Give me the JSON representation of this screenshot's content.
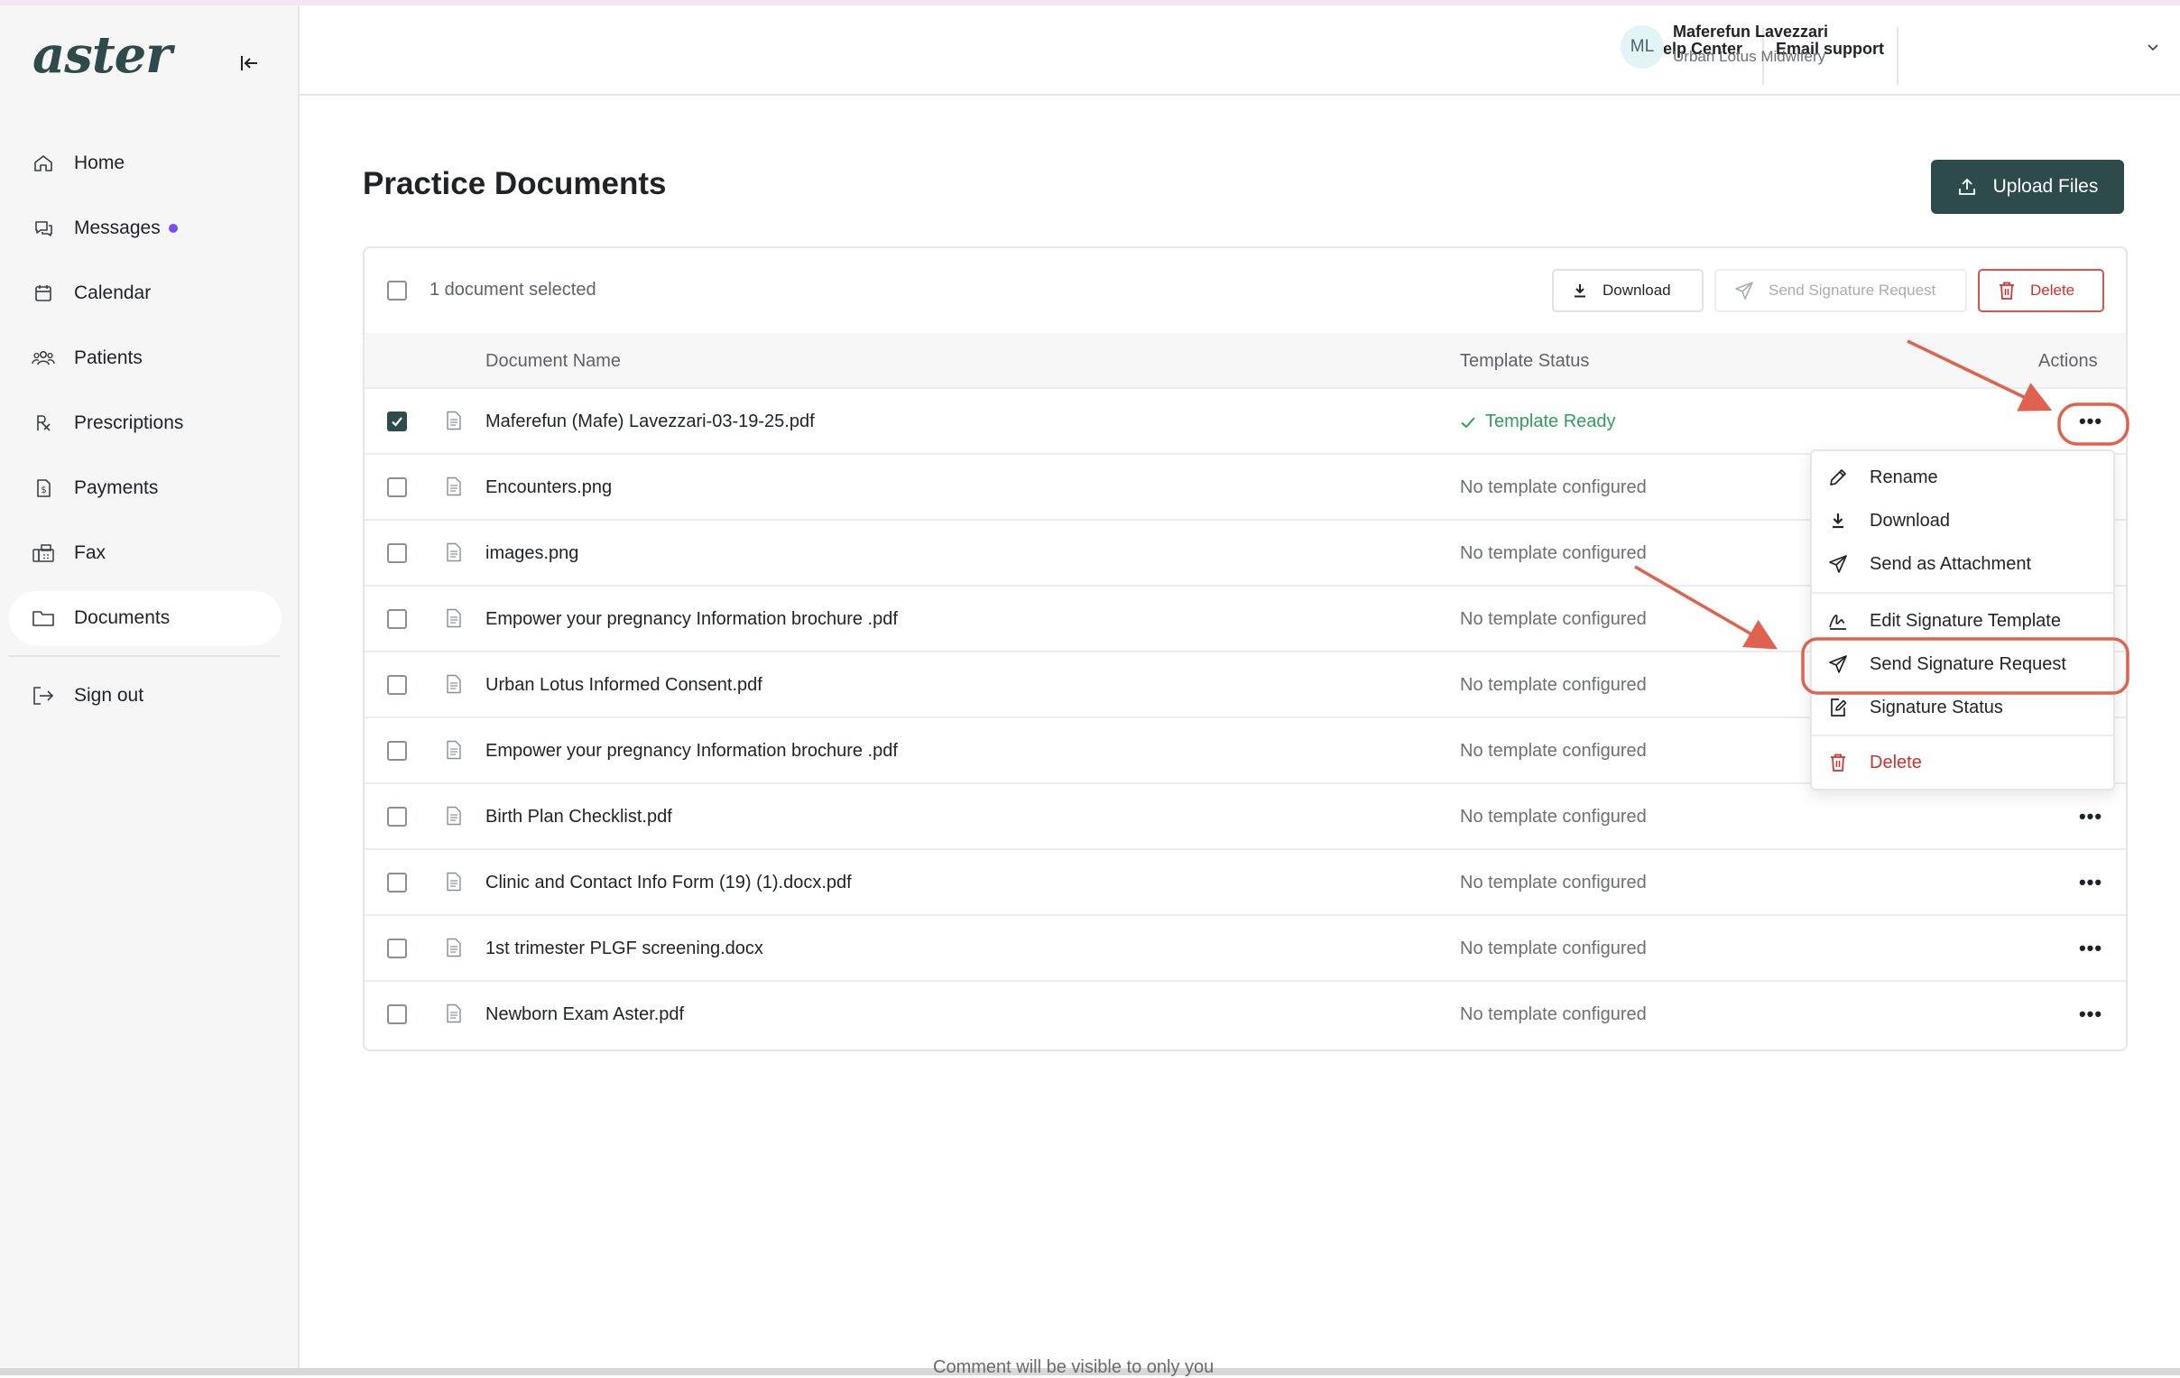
{
  "app": {
    "logo": "aster",
    "colors": {
      "primary": "#2e4b4b",
      "danger": "#d12f2f",
      "success": "#2f9e5b",
      "accent_dot": "#7c4dff",
      "annotation": "#e0624e"
    }
  },
  "sidebar": {
    "items": [
      {
        "label": "Home",
        "icon": "home-icon"
      },
      {
        "label": "Messages",
        "icon": "messages-icon",
        "unread_dot": true
      },
      {
        "label": "Calendar",
        "icon": "calendar-icon"
      },
      {
        "label": "Patients",
        "icon": "patients-icon"
      },
      {
        "label": "Prescriptions",
        "icon": "prescriptions-icon"
      },
      {
        "label": "Payments",
        "icon": "payments-icon"
      },
      {
        "label": "Fax",
        "icon": "fax-icon"
      },
      {
        "label": "Documents",
        "icon": "folder-icon",
        "active": true
      }
    ],
    "signout": "Sign out"
  },
  "header": {
    "help_center": "Help Center",
    "email_support": "Email support",
    "user": {
      "initials": "ML",
      "name": "Maferefun Lavezzari",
      "org": "Urban Lotus Midwifery"
    }
  },
  "main": {
    "title": "Practice Documents",
    "upload_label": "Upload Files",
    "toolbar": {
      "selected_text": "1 document selected",
      "download": "Download",
      "send_signature_request": "Send Signature Request",
      "delete": "Delete"
    },
    "columns": {
      "name": "Document Name",
      "status": "Template Status",
      "actions": "Actions"
    },
    "rows": [
      {
        "name": "Maferefun (Mafe) Lavezzari-03-19-25.pdf",
        "status": "Template Ready",
        "checked": true
      },
      {
        "name": "Encounters.png",
        "status": "No template configured",
        "checked": false
      },
      {
        "name": "images.png",
        "status": "No template configured",
        "checked": false
      },
      {
        "name": "Empower your pregnancy Information brochure .pdf",
        "status": "No template configured",
        "checked": false
      },
      {
        "name": "Urban Lotus Informed Consent.pdf",
        "status": "No template configured",
        "checked": false
      },
      {
        "name": "Empower your pregnancy Information brochure .pdf",
        "status": "No template configured",
        "checked": false
      },
      {
        "name": "Birth Plan Checklist.pdf",
        "status": "No template configured",
        "checked": false
      },
      {
        "name": "Clinic and Contact Info Form (19) (1).docx.pdf",
        "status": "No template configured",
        "checked": false
      },
      {
        "name": "1st trimester PLGF screening.docx",
        "status": "No template configured",
        "checked": false
      },
      {
        "name": "Newborn Exam Aster.pdf",
        "status": "No template configured",
        "checked": false
      }
    ]
  },
  "menu": {
    "items": [
      {
        "label": "Rename",
        "icon": "pencil-icon"
      },
      {
        "label": "Download",
        "icon": "download-icon"
      },
      {
        "label": "Send as Attachment",
        "icon": "send-icon"
      },
      {
        "label": "Edit Signature Template",
        "icon": "signature-icon"
      },
      {
        "label": "Send Signature Request",
        "icon": "send-icon",
        "highlighted": true
      },
      {
        "label": "Signature Status",
        "icon": "edit-doc-icon"
      },
      {
        "label": "Delete",
        "icon": "trash-icon"
      }
    ]
  },
  "footer": {
    "comment_note": "Comment will be visible to only you"
  }
}
